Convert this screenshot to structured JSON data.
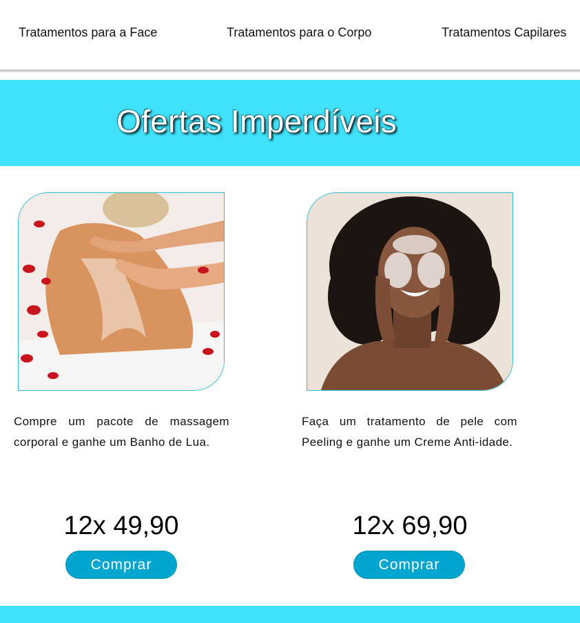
{
  "nav": {
    "links": [
      {
        "label": "Tratamentos para a Face"
      },
      {
        "label": "Tratamentos para o Corpo"
      },
      {
        "label": "Tratamentos Capilares"
      }
    ]
  },
  "banner": {
    "title": "Ofertas Imperdíveis"
  },
  "offers": [
    {
      "image": "massage-photo",
      "description": "Compre um pacote de massagem corporal e ganhe um Banho de Lua.",
      "price": "12x 49,90",
      "button_label": "Comprar"
    },
    {
      "image": "face-mask-photo",
      "description": "Faça um tratamento de pele com Peeling e ganhe um Creme Anti-idade.",
      "price": "12x 69,90",
      "button_label": "Comprar"
    }
  ],
  "colors": {
    "accent": "#3fe1fb",
    "button": "#00a6cf",
    "image_border": "#2bbcd6"
  }
}
